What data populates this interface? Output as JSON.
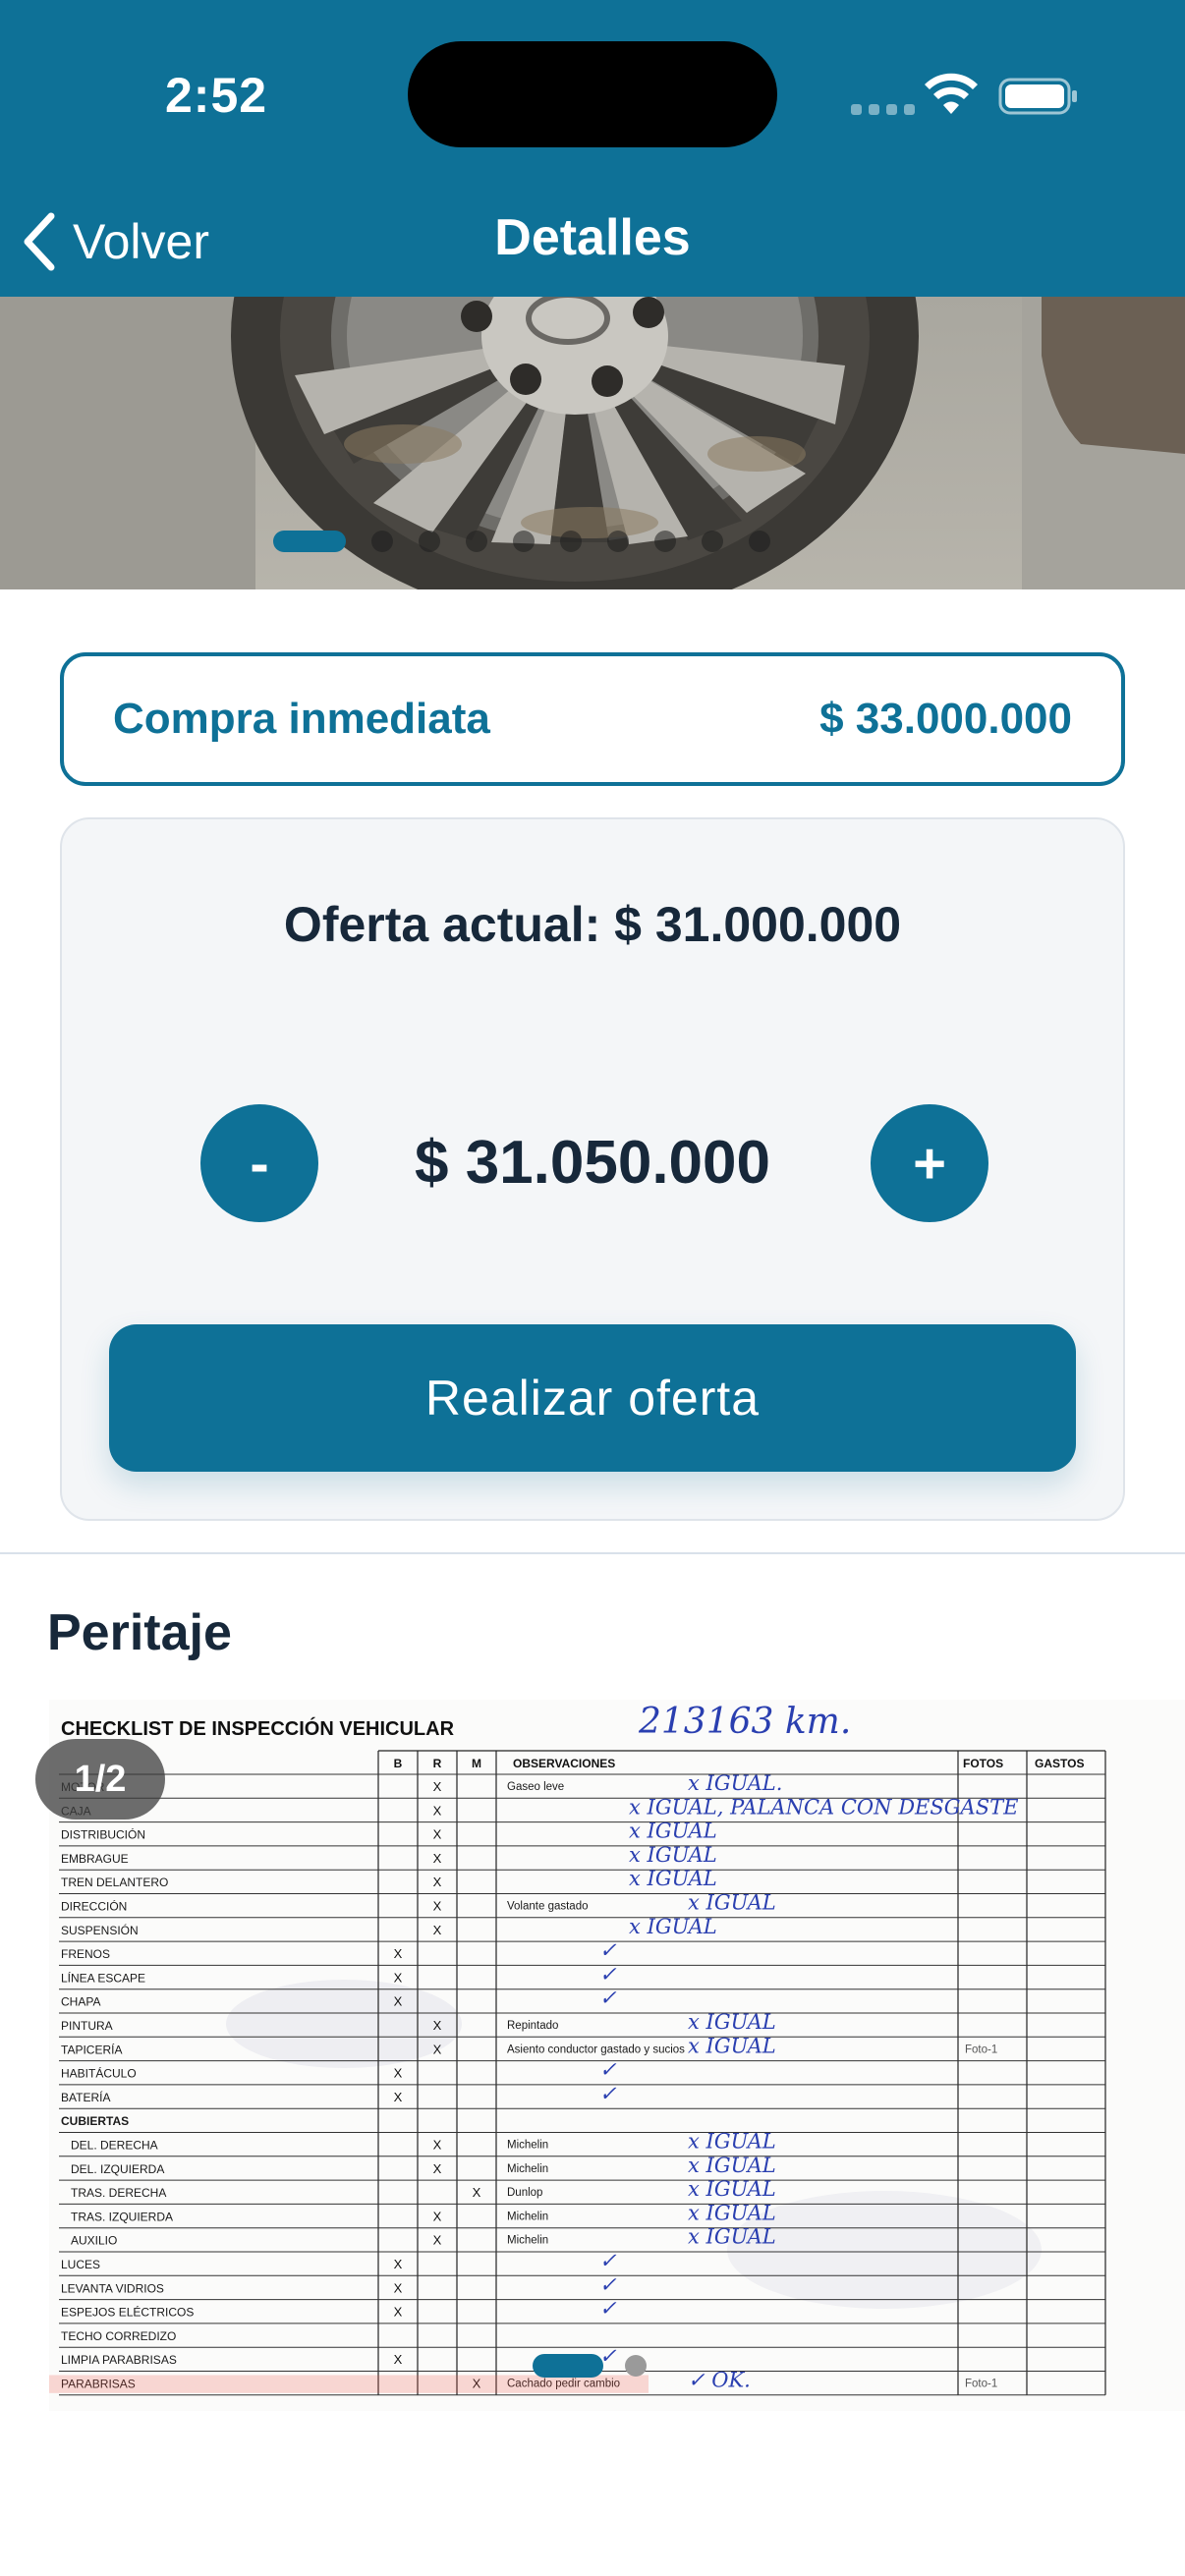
{
  "status_bar": {
    "time": "2:52"
  },
  "nav": {
    "back_label": "Volver",
    "title": "Detalles"
  },
  "photo_carousel": {
    "total_slides": 11,
    "active_index": 0
  },
  "buy_now": {
    "label": "Compra inmediata",
    "price": "$ 33.000.000"
  },
  "offer": {
    "current_label": "Oferta actual: $ 31.000.000",
    "decrement_label": "-",
    "increment_label": "+",
    "bid_amount": "$ 31.050.000",
    "submit_label": "Realizar oferta"
  },
  "peritaje": {
    "title": "Peritaje",
    "counter": "1/2",
    "total_pages": 2,
    "active_page": 0,
    "document": {
      "heading": "CHECKLIST DE INSPECCIÓN VEHICULAR",
      "handwritten_km": "213163 km.",
      "columns": [
        "B",
        "R",
        "M",
        "OBSERVACIONES",
        "FOTOS",
        "GASTOS"
      ],
      "rows": [
        {
          "item": "MOTOR",
          "mark": "R",
          "obs": "Gaseo leve",
          "hand": "x IGUAL.",
          "foto": ""
        },
        {
          "item": "CAJA",
          "mark": "R",
          "obs": "",
          "hand": "x IGUAL, PALANCA CON DESGASTE",
          "foto": ""
        },
        {
          "item": "DISTRIBUCIÓN",
          "mark": "R",
          "obs": "",
          "hand": "x IGUAL",
          "foto": ""
        },
        {
          "item": "EMBRAGUE",
          "mark": "R",
          "obs": "",
          "hand": "x IGUAL",
          "foto": ""
        },
        {
          "item": "TREN DELANTERO",
          "mark": "R",
          "obs": "",
          "hand": "x IGUAL",
          "foto": ""
        },
        {
          "item": "DIRECCIÓN",
          "mark": "R",
          "obs": "Volante gastado",
          "hand": "x IGUAL",
          "foto": ""
        },
        {
          "item": "SUSPENSIÓN",
          "mark": "R",
          "obs": "",
          "hand": "x IGUAL",
          "foto": ""
        },
        {
          "item": "FRENOS",
          "mark": "B",
          "obs": "",
          "hand": "✓",
          "foto": ""
        },
        {
          "item": "LÍNEA ESCAPE",
          "mark": "B",
          "obs": "",
          "hand": "✓",
          "foto": ""
        },
        {
          "item": "CHAPA",
          "mark": "B",
          "obs": "",
          "hand": "✓",
          "foto": ""
        },
        {
          "item": "PINTURA",
          "mark": "R",
          "obs": "Repintado",
          "hand": "x IGUAL",
          "foto": ""
        },
        {
          "item": "TAPICERÍA",
          "mark": "R",
          "obs": "Asiento conductor gastado y sucios",
          "hand": "x IGUAL",
          "foto": "Foto-1"
        },
        {
          "item": "HABITÁCULO",
          "mark": "B",
          "obs": "",
          "hand": "✓",
          "foto": ""
        },
        {
          "item": "BATERÍA",
          "mark": "B",
          "obs": "",
          "hand": "✓",
          "foto": ""
        },
        {
          "item": "CUBIERTAS",
          "mark": "",
          "obs": "",
          "hand": "",
          "foto": ""
        },
        {
          "item": "DEL. DERECHA",
          "mark": "R",
          "obs": "Michelin",
          "hand": "x IGUAL",
          "foto": ""
        },
        {
          "item": "DEL. IZQUIERDA",
          "mark": "R",
          "obs": "Michelin",
          "hand": "x IGUAL",
          "foto": ""
        },
        {
          "item": "TRAS. DERECHA",
          "mark": "M",
          "obs": "Dunlop",
          "hand": "x IGUAL",
          "foto": ""
        },
        {
          "item": "TRAS. IZQUIERDA",
          "mark": "R",
          "obs": "Michelin",
          "hand": "x IGUAL",
          "foto": ""
        },
        {
          "item": "AUXILIO",
          "mark": "R",
          "obs": "Michelin",
          "hand": "x IGUAL",
          "foto": ""
        },
        {
          "item": "LUCES",
          "mark": "B",
          "obs": "",
          "hand": "✓",
          "foto": ""
        },
        {
          "item": "LEVANTA VIDRIOS",
          "mark": "B",
          "obs": "",
          "hand": "✓",
          "foto": ""
        },
        {
          "item": "ESPEJOS ELÉCTRICOS",
          "mark": "B",
          "obs": "",
          "hand": "✓",
          "foto": ""
        },
        {
          "item": "TECHO CORREDIZO",
          "mark": "",
          "obs": "",
          "hand": "",
          "foto": ""
        },
        {
          "item": "LIMPIA PARABRISAS",
          "mark": "B",
          "obs": "",
          "hand": "✓",
          "foto": ""
        },
        {
          "item": "PARABRISAS",
          "mark": "M",
          "obs": "Cachado pedir cambio",
          "hand": "✓ OK.",
          "foto": "Foto-1"
        }
      ]
    }
  },
  "colors": {
    "brand": "#0e7197",
    "text_dark": "#17283a",
    "card_bg": "#f4f6f8",
    "pen_ink": "#2a3fb0"
  }
}
